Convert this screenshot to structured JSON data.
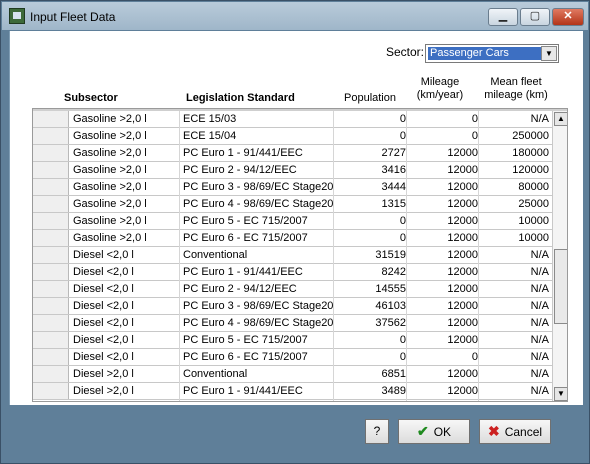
{
  "window": {
    "title": "Input Fleet Data",
    "min_glyph": "▁",
    "max_glyph": "▢",
    "close_glyph": "✕"
  },
  "sector": {
    "label": "Sector:",
    "value": "Passenger Cars"
  },
  "columns": {
    "subsector": "Subsector",
    "legislation": "Legislation Standard",
    "population": "Population",
    "mileage_l1": "Mileage",
    "mileage_l2": "(km/year)",
    "mean_l1": "Mean fleet",
    "mean_l2": "mileage (km)"
  },
  "rows": [
    {
      "subsector": "Gasoline >2,0 l",
      "legislation": "ECE 15/03",
      "population": "0",
      "mileage": "0",
      "mean": "N/A"
    },
    {
      "subsector": "Gasoline >2,0 l",
      "legislation": "ECE 15/04",
      "population": "0",
      "mileage": "0",
      "mean": "250000"
    },
    {
      "subsector": "Gasoline >2,0 l",
      "legislation": "PC Euro 1 - 91/441/EEC",
      "population": "2727",
      "mileage": "12000",
      "mean": "180000"
    },
    {
      "subsector": "Gasoline >2,0 l",
      "legislation": "PC Euro 2 - 94/12/EEC",
      "population": "3416",
      "mileage": "12000",
      "mean": "120000"
    },
    {
      "subsector": "Gasoline >2,0 l",
      "legislation": "PC Euro 3 - 98/69/EC Stage20",
      "population": "3444",
      "mileage": "12000",
      "mean": "80000"
    },
    {
      "subsector": "Gasoline >2,0 l",
      "legislation": "PC Euro 4 - 98/69/EC Stage20",
      "population": "1315",
      "mileage": "12000",
      "mean": "25000"
    },
    {
      "subsector": "Gasoline >2,0 l",
      "legislation": "PC Euro 5 - EC 715/2007",
      "population": "0",
      "mileage": "12000",
      "mean": "10000"
    },
    {
      "subsector": "Gasoline >2,0 l",
      "legislation": "PC Euro 6 - EC 715/2007",
      "population": "0",
      "mileage": "12000",
      "mean": "10000"
    },
    {
      "subsector": "Diesel <2,0 l",
      "legislation": "Conventional",
      "population": "31519",
      "mileage": "12000",
      "mean": "N/A"
    },
    {
      "subsector": "Diesel <2,0 l",
      "legislation": "PC Euro 1 - 91/441/EEC",
      "population": "8242",
      "mileage": "12000",
      "mean": "N/A"
    },
    {
      "subsector": "Diesel <2,0 l",
      "legislation": "PC Euro 2 - 94/12/EEC",
      "population": "14555",
      "mileage": "12000",
      "mean": "N/A"
    },
    {
      "subsector": "Diesel <2,0 l",
      "legislation": "PC Euro 3 - 98/69/EC Stage20",
      "population": "46103",
      "mileage": "12000",
      "mean": "N/A"
    },
    {
      "subsector": "Diesel <2,0 l",
      "legislation": "PC Euro 4 - 98/69/EC Stage20",
      "population": "37562",
      "mileage": "12000",
      "mean": "N/A"
    },
    {
      "subsector": "Diesel <2,0 l",
      "legislation": "PC Euro 5 - EC 715/2007",
      "population": "0",
      "mileage": "12000",
      "mean": "N/A"
    },
    {
      "subsector": "Diesel <2,0 l",
      "legislation": "PC Euro 6 - EC 715/2007",
      "population": "0",
      "mileage": "0",
      "mean": "N/A"
    },
    {
      "subsector": "Diesel >2,0 l",
      "legislation": "Conventional",
      "population": "6851",
      "mileage": "12000",
      "mean": "N/A"
    },
    {
      "subsector": "Diesel >2,0 l",
      "legislation": "PC Euro 1 - 91/441/EEC",
      "population": "3489",
      "mileage": "12000",
      "mean": "N/A"
    }
  ],
  "buttons": {
    "help": "?",
    "ok": "OK",
    "ok_icon": "✔",
    "cancel": "Cancel",
    "cancel_icon": "✖"
  },
  "scroll": {
    "up": "▲",
    "down": "▼"
  }
}
